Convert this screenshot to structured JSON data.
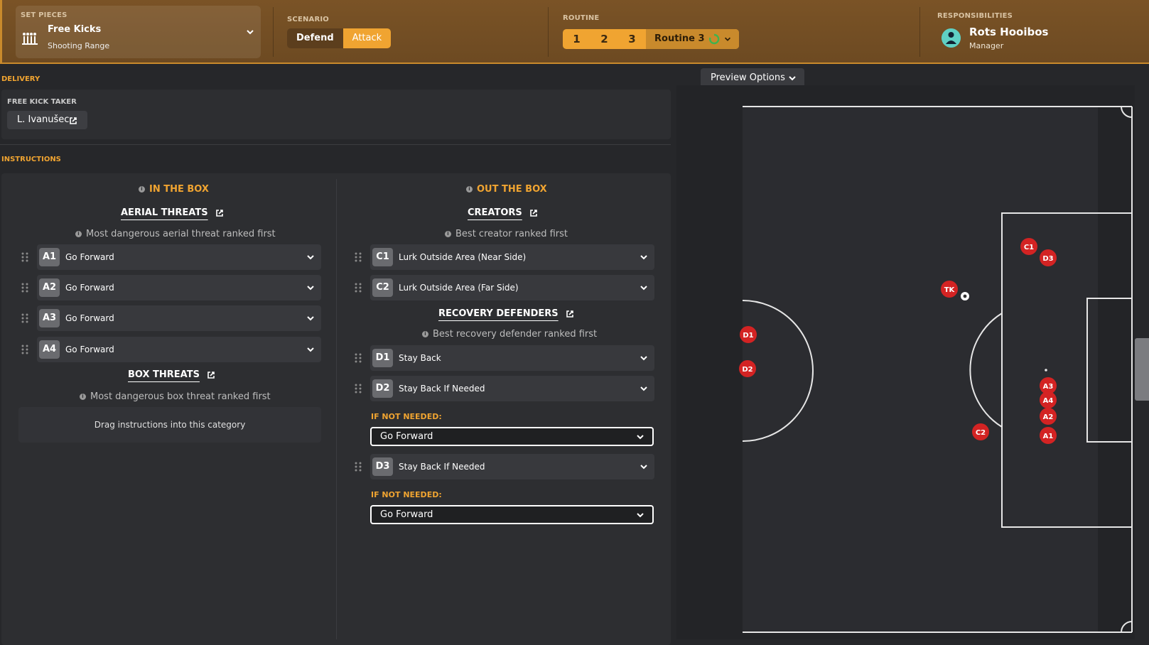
{
  "header": {
    "set_pieces": {
      "label": "SET PIECES",
      "title": "Free Kicks",
      "subtitle": "Shooting Range"
    },
    "scenario": {
      "label": "SCENARIO",
      "options": [
        "Defend",
        "Attack"
      ],
      "selected": "Attack"
    },
    "routine": {
      "label": "ROUTINE",
      "numbers": [
        "1",
        "2",
        "3"
      ],
      "selected_label": "Routine 3"
    },
    "responsibilities": {
      "label": "RESPONSIBILITIES",
      "name": "Rots Hooibos",
      "role": "Manager"
    }
  },
  "delivery": {
    "label": "DELIVERY",
    "taker_label": "FREE KICK TAKER",
    "taker_name": "L. Ivanušec"
  },
  "instructions": {
    "label": "INSTRUCTIONS",
    "in_box": {
      "heading": "IN THE BOX",
      "aerial": {
        "title": "AERIAL THREATS",
        "hint": "Most dangerous aerial threat ranked first",
        "rows": [
          {
            "tag": "A1",
            "value": "Go Forward"
          },
          {
            "tag": "A2",
            "value": "Go Forward"
          },
          {
            "tag": "A3",
            "value": "Go Forward"
          },
          {
            "tag": "A4",
            "value": "Go Forward"
          }
        ]
      },
      "box": {
        "title": "BOX THREATS",
        "hint": "Most dangerous box threat ranked first",
        "empty": "Drag instructions into this category"
      }
    },
    "out_box": {
      "heading": "OUT THE BOX",
      "creators": {
        "title": "CREATORS",
        "hint": "Best creator ranked first",
        "rows": [
          {
            "tag": "C1",
            "value": "Lurk Outside Area (Near Side)"
          },
          {
            "tag": "C2",
            "value": "Lurk Outside Area (Far Side)"
          }
        ]
      },
      "recovery": {
        "title": "RECOVERY DEFENDERS",
        "hint": "Best recovery defender ranked first",
        "rows": [
          {
            "tag": "D1",
            "value": "Stay Back"
          },
          {
            "tag": "D2",
            "value": "Stay Back If Needed",
            "if_not_label": "IF NOT NEEDED:",
            "if_not_value": "Go Forward"
          },
          {
            "tag": "D3",
            "value": "Stay Back If Needed",
            "if_not_label": "IF NOT NEEDED:",
            "if_not_value": "Go Forward"
          }
        ]
      }
    }
  },
  "preview": {
    "options_label": "Preview Options",
    "markers": [
      "C1",
      "D3",
      "TK",
      "D1",
      "D2",
      "A3",
      "A4",
      "A2",
      "C2",
      "A1"
    ]
  },
  "colors": {
    "accent": "#f0a431",
    "header_bg": "#6d4a22",
    "marker": "#d32323",
    "pitch_line": "#e6e6e6"
  }
}
